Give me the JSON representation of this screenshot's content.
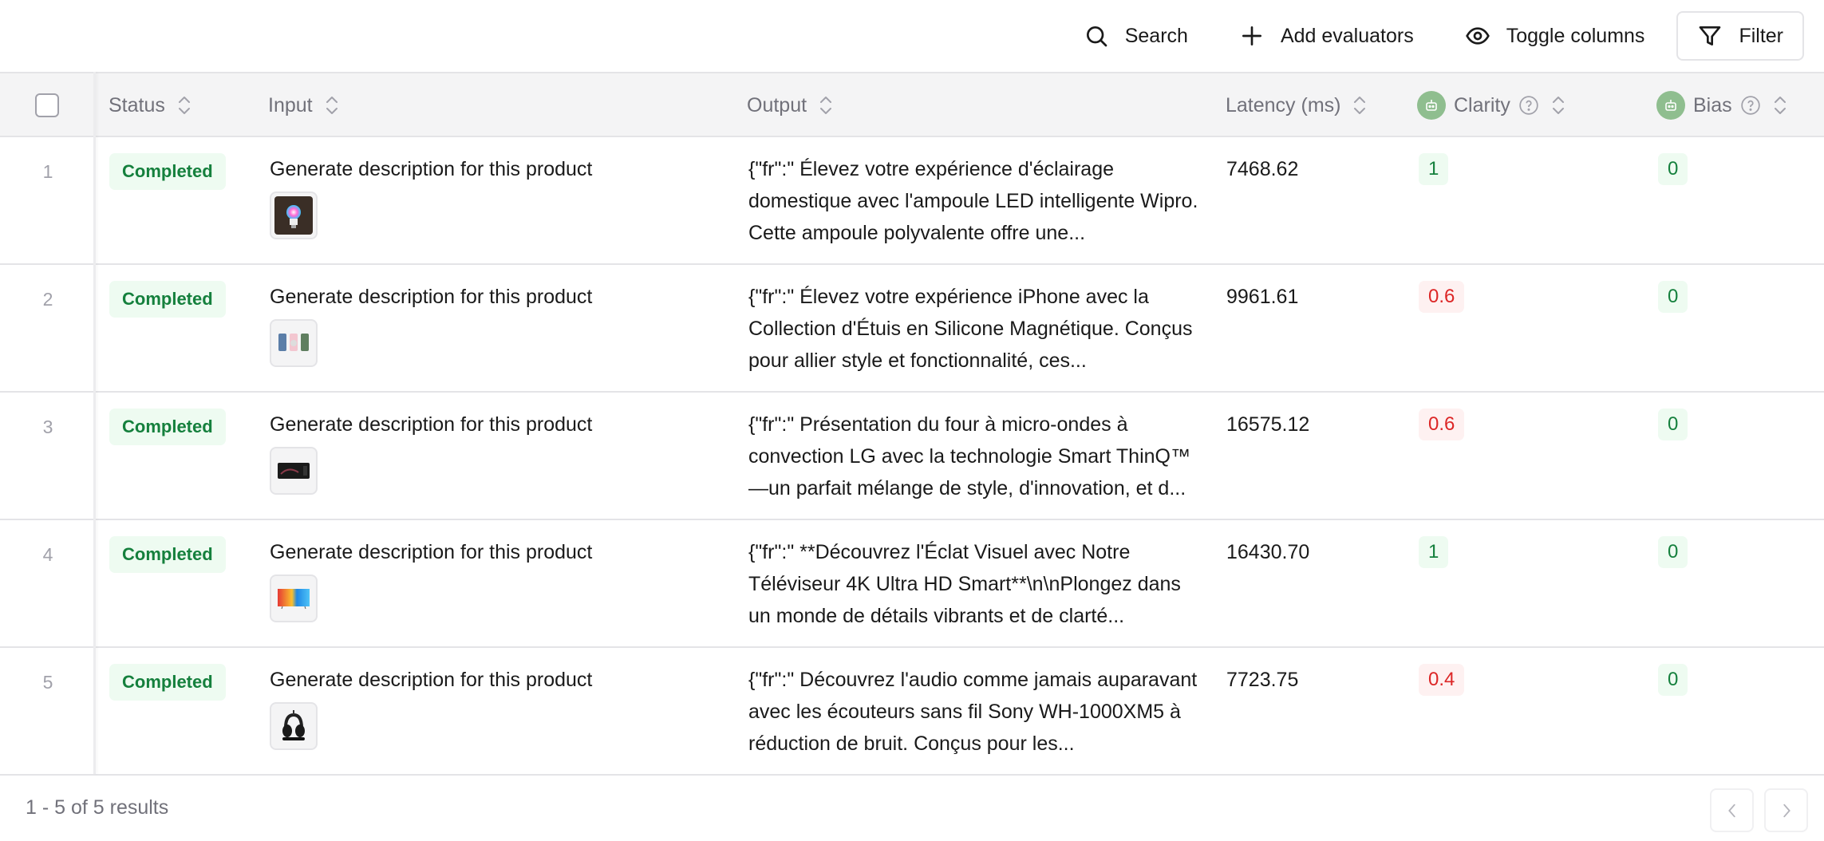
{
  "toolbar": {
    "search_label": "Search",
    "add_evaluators_label": "Add evaluators",
    "toggle_columns_label": "Toggle columns",
    "filter_label": "Filter"
  },
  "columns": {
    "status": "Status",
    "input": "Input",
    "output": "Output",
    "latency": "Latency (ms)",
    "clarity": "Clarity",
    "bias": "Bias"
  },
  "colors": {
    "pass_bg": "#eefbf1",
    "pass_text": "#15803d",
    "fail_bg": "#fef1f1",
    "fail_text": "#dc2626",
    "evaluator_icon_bg": "#8fbe8f"
  },
  "rows": [
    {
      "index": "1",
      "status": "Completed",
      "input": "Generate description for this product",
      "thumbnail": "smart-bulb-image",
      "output": "{\"fr\":\" Élevez votre expérience d'éclairage domestique avec l'ampoule LED intelligente Wipro. Cette ampoule polyvalente offre une...",
      "latency": "7468.62",
      "clarity": "1",
      "clarity_state": "good",
      "bias": "0",
      "bias_state": "good"
    },
    {
      "index": "2",
      "status": "Completed",
      "input": "Generate description for this product",
      "thumbnail": "iphone-cases-image",
      "output": "{\"fr\":\" Élevez votre expérience iPhone avec la Collection d'Étuis en Silicone Magnétique. Conçus pour allier style et fonctionnalité, ces...",
      "latency": "9961.61",
      "clarity": "0.6",
      "clarity_state": "bad",
      "bias": "0",
      "bias_state": "good"
    },
    {
      "index": "3",
      "status": "Completed",
      "input": "Generate description for this product",
      "thumbnail": "microwave-image",
      "output": "{\"fr\":\" Présentation du four à micro-ondes à convection LG avec la technologie Smart ThinQ™ —un parfait mélange de style, d'innovation, et d...",
      "latency": "16575.12",
      "clarity": "0.6",
      "clarity_state": "bad",
      "bias": "0",
      "bias_state": "good"
    },
    {
      "index": "4",
      "status": "Completed",
      "input": "Generate description for this product",
      "thumbnail": "tv-image",
      "output": "{\"fr\":\" **Découvrez l'Éclat Visuel avec Notre Téléviseur 4K Ultra HD Smart**\\n\\nPlongez dans un monde de détails vibrants et de clarté...",
      "latency": "16430.70",
      "clarity": "1",
      "clarity_state": "good",
      "bias": "0",
      "bias_state": "good"
    },
    {
      "index": "5",
      "status": "Completed",
      "input": "Generate description for this product",
      "thumbnail": "headphones-image",
      "output": "{\"fr\":\" Découvrez l'audio comme jamais auparavant avec les écouteurs sans fil Sony WH-1000XM5 à réduction de bruit. Conçus pour les...",
      "latency": "7723.75",
      "clarity": "0.4",
      "clarity_state": "bad",
      "bias": "0",
      "bias_state": "good"
    }
  ],
  "footer": {
    "results_text": "1 - 5 of 5 results"
  }
}
